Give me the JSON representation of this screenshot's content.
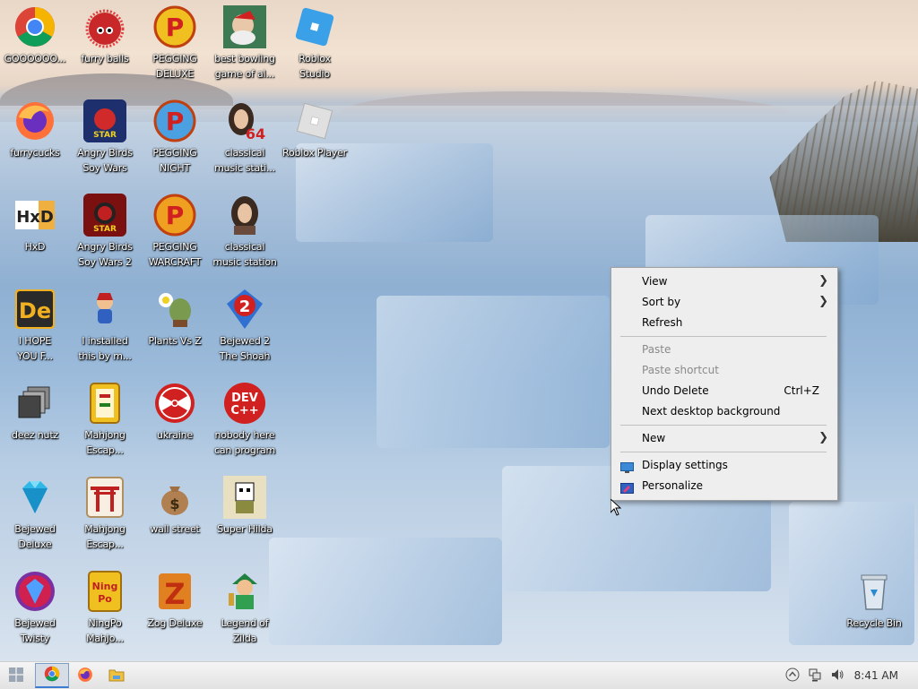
{
  "desktop": {
    "icons": [
      {
        "label": "GOOOOOO...",
        "icon": "chrome-icon"
      },
      {
        "label": "furry balls",
        "icon": "red-fuzzball-icon"
      },
      {
        "label": "PEGGING\nDELUXE",
        "icon": "pegging-p-icon"
      },
      {
        "label": "best bowling\ngame of al...",
        "icon": "bowling-santa-icon"
      },
      {
        "label": "Roblox\nStudio",
        "icon": "roblox-studio-icon"
      },
      {
        "label": "furrycucks",
        "icon": "firefox-icon"
      },
      {
        "label": "Angry Birds\nSoy Wars",
        "icon": "angry-birds-star-wars-icon"
      },
      {
        "label": "PEGGING\nNIGHT",
        "icon": "pegging-p-icon"
      },
      {
        "label": "classical\nmusic stati...",
        "icon": "portrait-64-icon"
      },
      {
        "label": "Roblox Player",
        "icon": "roblox-player-icon"
      },
      {
        "label": "HxD",
        "icon": "hxd-icon"
      },
      {
        "label": "Angry Birds\nSoy Wars 2",
        "icon": "angry-birds-star-wars-2-icon"
      },
      {
        "label": "PEGGING\nWARCRAFT",
        "icon": "pegging-p-icon"
      },
      {
        "label": "classical\nmusic station",
        "icon": "portrait-icon"
      },
      {
        "label": "I HOPE\nYOU F...",
        "icon": "de-icon"
      },
      {
        "label": "I installed\nthis by m...",
        "icon": "cartoon-character-icon"
      },
      {
        "label": "Plants Vs Z",
        "icon": "plants-vs-zombies-icon"
      },
      {
        "label": "Bejewed 2\nThe Shoah",
        "icon": "bejeweled-2-icon"
      },
      {
        "label": "deez nutz",
        "icon": "stacked-windows-icon"
      },
      {
        "label": "Mahjong\nEscap...",
        "icon": "mahjong-tile-icon"
      },
      {
        "label": "ukraine",
        "icon": "radiation-icon"
      },
      {
        "label": "nobody here\ncan program",
        "icon": "dev-cpp-icon"
      },
      {
        "label": "Bejewed\nDeluxe",
        "icon": "diamond-icon"
      },
      {
        "label": "Mahjong\nEscap...",
        "icon": "torii-gate-icon"
      },
      {
        "label": "wall street",
        "icon": "money-bag-icon"
      },
      {
        "label": "Super Hilda",
        "icon": "pixel-character-icon"
      },
      {
        "label": "Bejewed\nTwisty",
        "icon": "bejeweled-twist-icon"
      },
      {
        "label": "NingPo\nMahJo...",
        "icon": "ningpo-tile-icon"
      },
      {
        "label": "Zog Deluxe",
        "icon": "zog-z-icon"
      },
      {
        "label": "Legend of\nZilda",
        "icon": "zilda-character-icon"
      },
      {
        "label": "Recycle Bin",
        "icon": "recycle-bin-icon"
      }
    ]
  },
  "context_menu": {
    "view": "View",
    "sort_by": "Sort by",
    "refresh": "Refresh",
    "paste": "Paste",
    "paste_shortcut": "Paste shortcut",
    "undo_delete": "Undo Delete",
    "undo_shortcut": "Ctrl+Z",
    "next_background": "Next desktop background",
    "new": "New",
    "display_settings": "Display settings",
    "personalize": "Personalize"
  },
  "taskbar": {
    "start": "windows-start-icon",
    "pinned": [
      "chrome-icon",
      "firefox-icon",
      "file-explorer-icon"
    ],
    "tray": [
      "up-arrow-icon",
      "network-icon",
      "volume-icon"
    ],
    "clock": "8:41 AM"
  }
}
